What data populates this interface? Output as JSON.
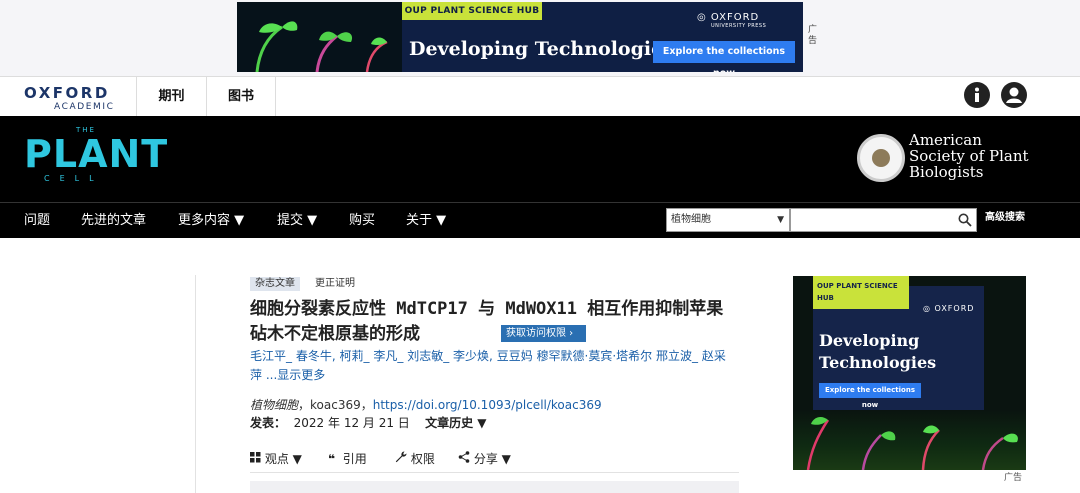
{
  "top_ad": {
    "hub_label": "OUP PLANT SCIENCE HUB",
    "title": "Developing Technologies",
    "oxford": "OXFORD",
    "oxford_sub": "UNIVERSITY PRESS",
    "explore_label": "Explore the collections now",
    "ad_label": "广告"
  },
  "oxford_header": {
    "logo_line1": "OXFORD",
    "logo_line2": "ACADEMIC",
    "nav": [
      "期刊",
      "图书"
    ],
    "info_icon": "info-icon",
    "user_icon": "user-icon"
  },
  "journal": {
    "logo_the": "THE",
    "logo_plant": "PLANT",
    "logo_cell": "CELL",
    "society_lines": [
      "American",
      "Society of Plant",
      "Biologists"
    ]
  },
  "navbar": {
    "items": [
      "问题",
      "先进的文章",
      "更多内容 ▼",
      "提交 ▼",
      "购买",
      "关于 ▼"
    ],
    "search_scope": "植物细胞",
    "search_value": "",
    "advanced_search": "高级搜索"
  },
  "article": {
    "type_tag": "杂志文章",
    "correction_tag": "更正证明",
    "title": "细胞分裂素反应性 MdTCP17 与 MdWOX11 相互作用抑制苹果砧木不定根原基的形成",
    "access_label": "获取访问权限 ›",
    "authors": [
      {
        "name": "毛江平",
        "sep": "_ "
      },
      {
        "name": "春冬牛",
        "sep": ", "
      },
      {
        "name": "柯莉",
        "sep": "_ "
      },
      {
        "name": "李凡",
        "sep": "_ "
      },
      {
        "name": "刘志敏",
        "sep": "_ "
      },
      {
        "name": "李少焕",
        "sep": ", "
      },
      {
        "name": "豆豆妈",
        "sep": " "
      },
      {
        "name": "穆罕默德·莫宾·塔希尔",
        "sep": " "
      },
      {
        "name": "邢立波",
        "sep": "_ "
      },
      {
        "name": "赵采萍",
        "sep": " "
      }
    ],
    "show_more": "...显示更多",
    "journal_name": "植物细胞",
    "article_id": "，koac369，",
    "doi": "https://doi.org/10.1093/plcell/koac369",
    "published_label": "发表：",
    "published_date": "2022 年 12 月 21 日",
    "history_label": "文章历史 ▼",
    "tools": [
      {
        "icon": "grid-icon",
        "label": "观点 ▼"
      },
      {
        "icon": "quote-icon",
        "label": "引用"
      },
      {
        "icon": "wrench-icon",
        "label": "权限"
      },
      {
        "icon": "share-icon",
        "label": "分享 ▼"
      }
    ]
  },
  "side_ad": {
    "hub_label": "OUP PLANT SCIENCE HUB",
    "oxford": "OXFORD",
    "title_line1": "Developing",
    "title_line2": "Technologies",
    "explore_label": "Explore the collections now",
    "ad_label": "广告"
  }
}
